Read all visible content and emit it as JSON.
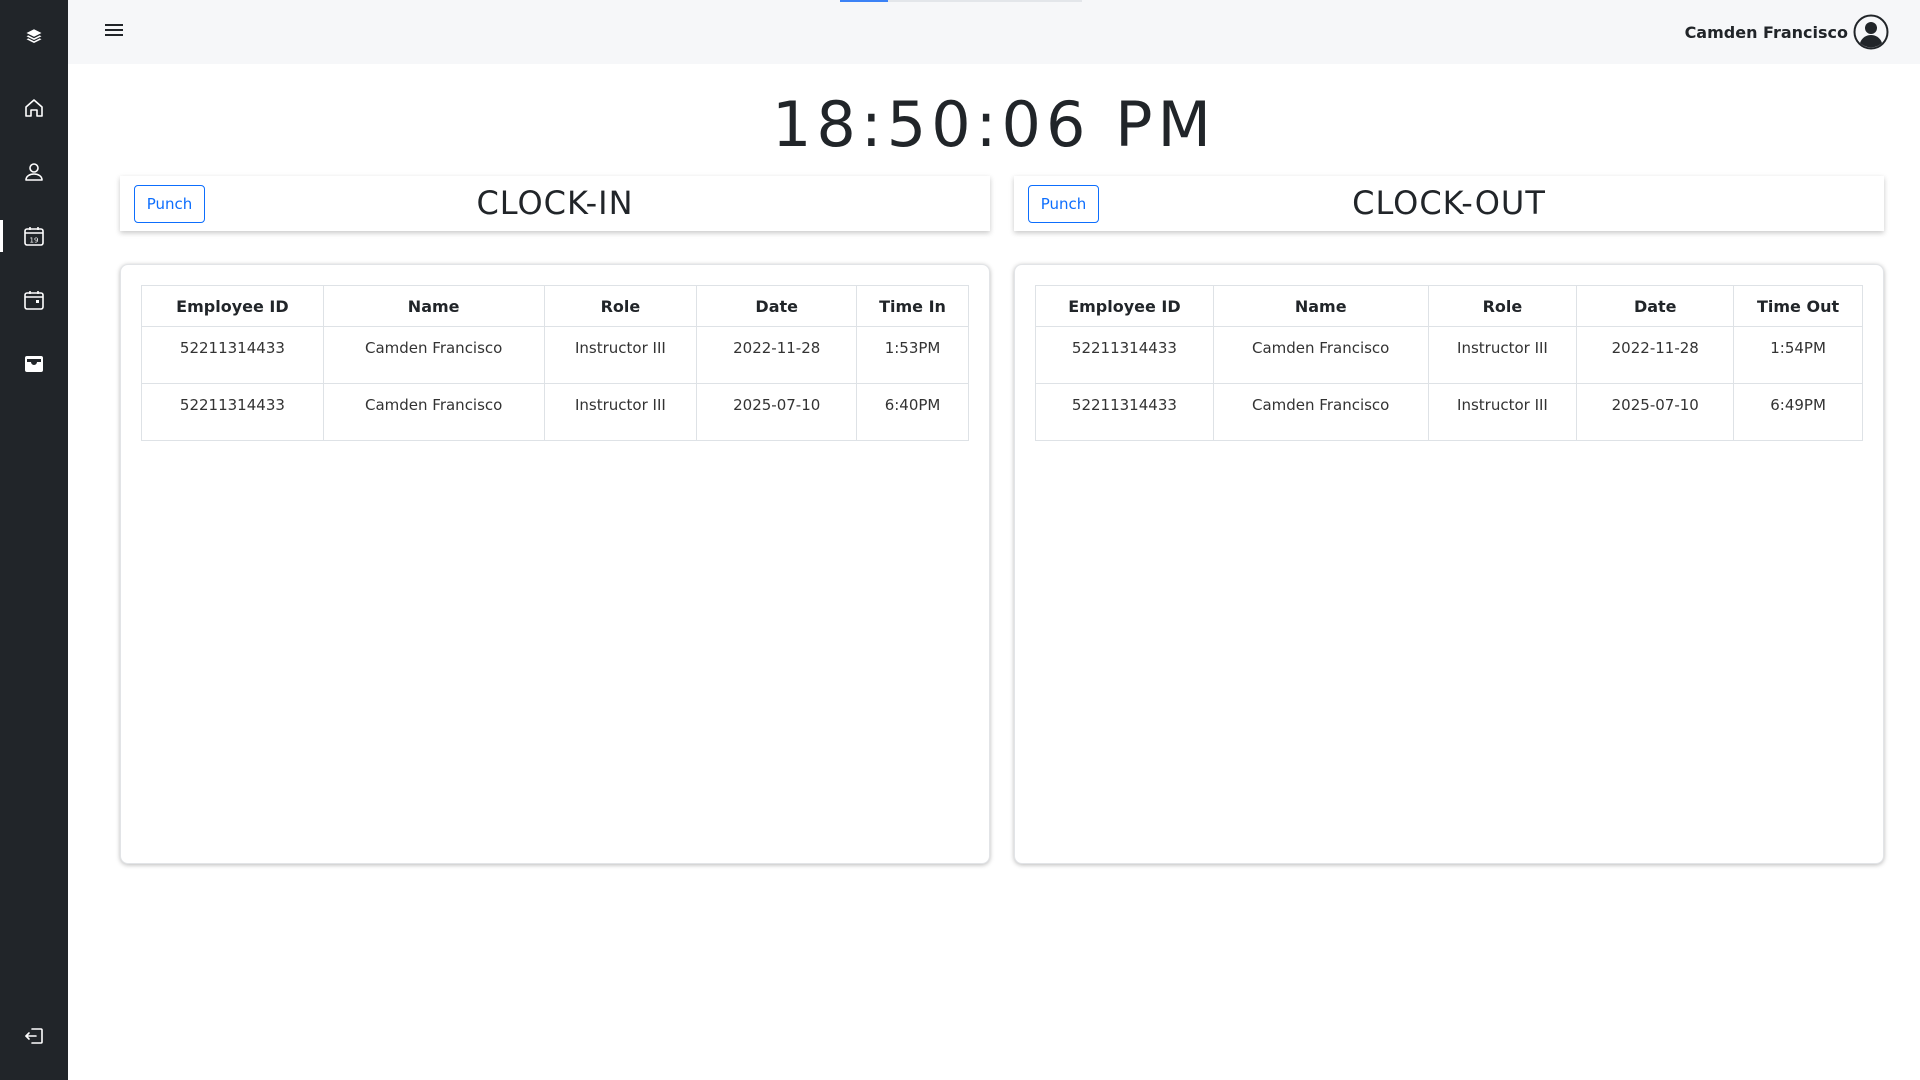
{
  "sidebar": {
    "items": [
      {
        "icon": "layers-icon"
      },
      {
        "icon": "home-icon"
      },
      {
        "icon": "user-icon"
      },
      {
        "icon": "calendar-day-icon",
        "day": "19",
        "active": true
      },
      {
        "icon": "calendar-icon"
      },
      {
        "icon": "inbox-icon"
      },
      {
        "icon": "logout-icon"
      }
    ]
  },
  "header": {
    "user_name": "Camden Francisco",
    "progress_fraction": 0.2
  },
  "clock": {
    "time": "18:50:06 PM"
  },
  "clock_in": {
    "button_label": "Punch",
    "title": "CLOCK-IN",
    "columns": [
      "Employee ID",
      "Name",
      "Role",
      "Date",
      "Time In"
    ],
    "rows": [
      [
        "52211314433",
        "Camden Francisco",
        "Instructor III",
        "2022-11-28",
        "1:53PM"
      ],
      [
        "52211314433",
        "Camden Francisco",
        "Instructor III",
        "2025-07-10",
        "6:40PM"
      ]
    ]
  },
  "clock_out": {
    "button_label": "Punch",
    "title": "CLOCK-OUT",
    "columns": [
      "Employee ID",
      "Name",
      "Role",
      "Date",
      "Time Out"
    ],
    "rows": [
      [
        "52211314433",
        "Camden Francisco",
        "Instructor III",
        "2022-11-28",
        "1:54PM"
      ],
      [
        "52211314433",
        "Camden Francisco",
        "Instructor III",
        "2025-07-10",
        "6:49PM"
      ]
    ]
  },
  "colors": {
    "sidebar_bg": "#212529",
    "header_bg": "#f6f7f9",
    "accent": "#0d6efd"
  }
}
